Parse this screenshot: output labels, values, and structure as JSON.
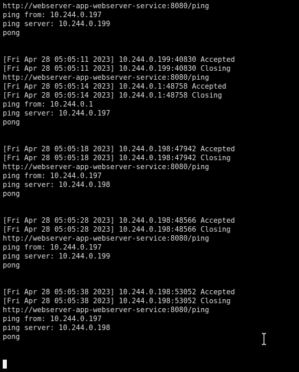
{
  "terminal": {
    "lines": [
      "http://webserver-app-webserver-service:8080/ping",
      "ping from: 10.244.0.197",
      "ping server: 10.244.0.199",
      "pong",
      "",
      "",
      "[Fri Apr 28 05:05:11 2023] 10.244.0.199:40830 Accepted",
      "[Fri Apr 28 05:05:11 2023] 10.244.0.199:40830 Closing",
      "http://webserver-app-webserver-service:8080/ping",
      "[Fri Apr 28 05:05:14 2023] 10.244.0.1:48758 Accepted",
      "[Fri Apr 28 05:05:14 2023] 10.244.0.1:48758 Closing",
      "ping from: 10.244.0.1",
      "ping server: 10.244.0.197",
      "pong",
      "",
      "",
      "[Fri Apr 28 05:05:18 2023] 10.244.0.198:47942 Accepted",
      "[Fri Apr 28 05:05:18 2023] 10.244.0.198:47942 Closing",
      "http://webserver-app-webserver-service:8080/ping",
      "ping from: 10.244.0.197",
      "ping server: 10.244.0.198",
      "pong",
      "",
      "",
      "[Fri Apr 28 05:05:28 2023] 10.244.0.198:48566 Accepted",
      "[Fri Apr 28 05:05:28 2023] 10.244.0.198:48566 Closing",
      "http://webserver-app-webserver-service:8080/ping",
      "ping from: 10.244.0.197",
      "ping server: 10.244.0.199",
      "pong",
      "",
      "",
      "[Fri Apr 28 05:05:38 2023] 10.244.0.198:53052 Accepted",
      "[Fri Apr 28 05:05:38 2023] 10.244.0.198:53052 Closing",
      "http://webserver-app-webserver-service:8080/ping",
      "ping from: 10.244.0.197",
      "ping server: 10.244.0.198",
      "pong"
    ],
    "colors": {
      "background": "#000000",
      "foreground": "#dcdcdc",
      "cursor": "#f0f0f0"
    },
    "cursor_icon": "text-cursor-icon",
    "block_cursor_icon": "block-cursor-icon"
  }
}
